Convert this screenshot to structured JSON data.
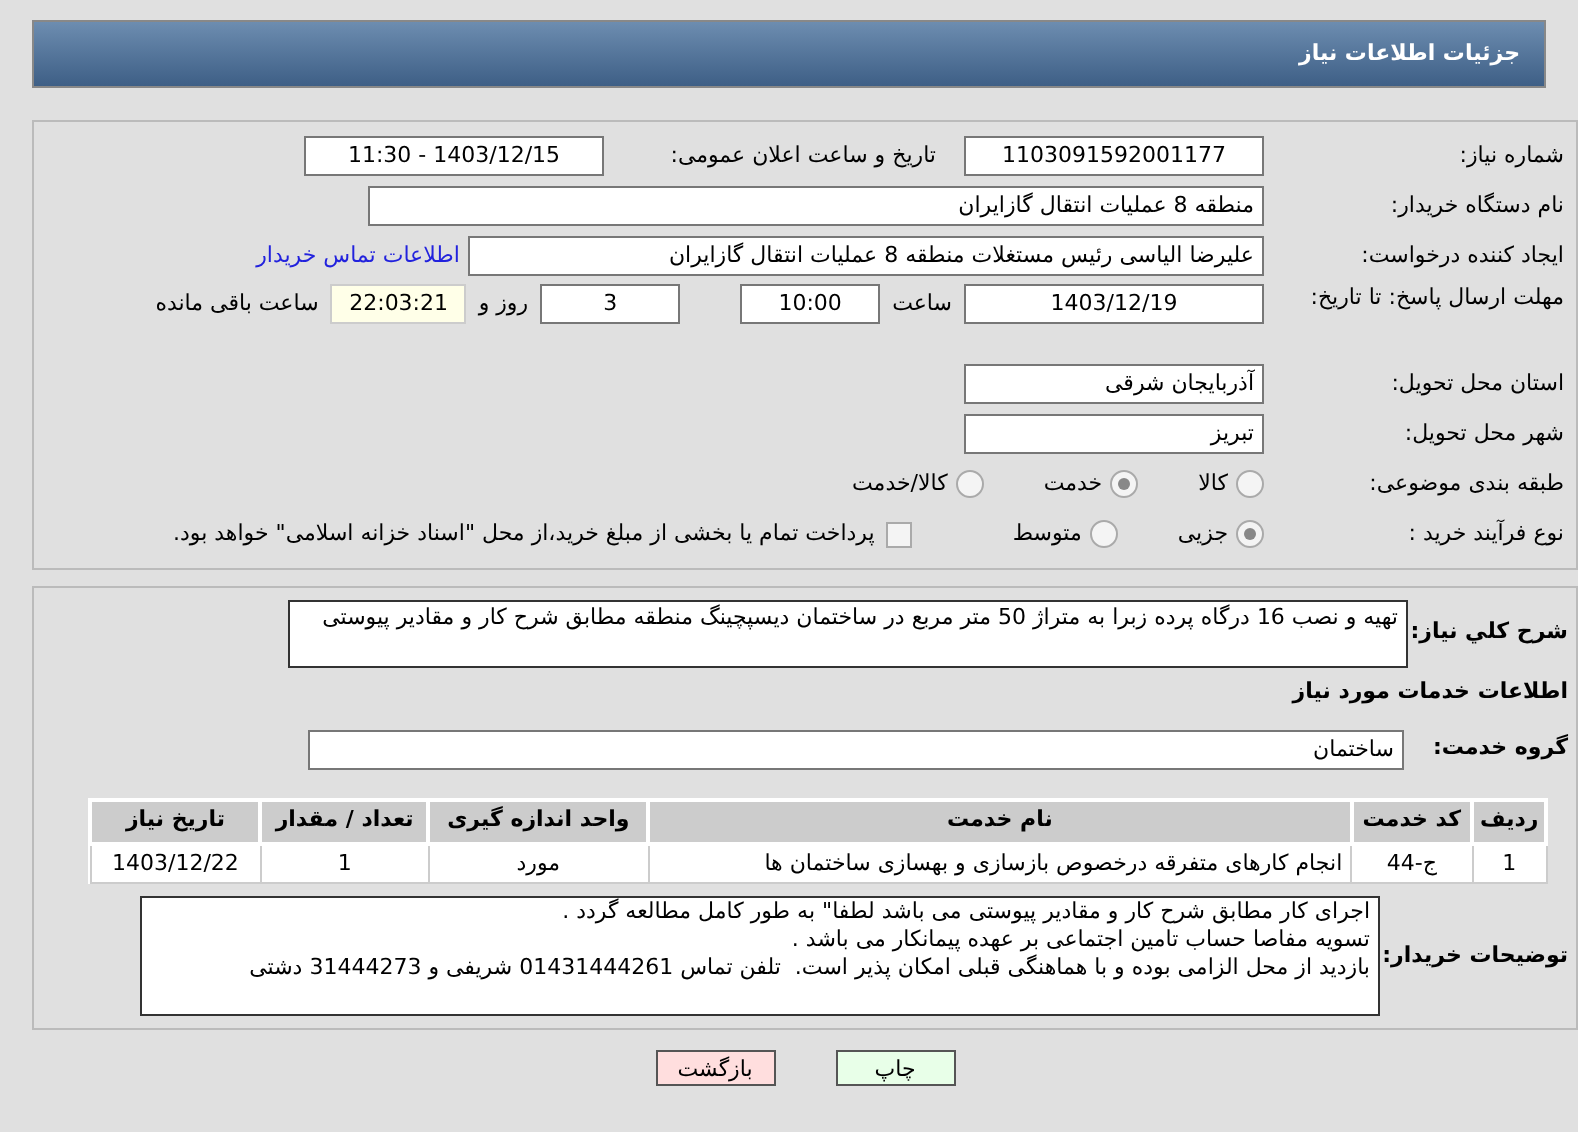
{
  "header": {
    "title": "جزئیات اطلاعات نیاز"
  },
  "details": {
    "need_number": {
      "label": "شماره نیاز:",
      "value": "1103091592001177"
    },
    "announce": {
      "label": "تاریخ و ساعت اعلان عمومی:",
      "value": "1403/12/15 - 11:30"
    },
    "buyer": {
      "label": "نام دستگاه خریدار:",
      "value": "منطقه 8 عملیات انتقال گازایران"
    },
    "creator": {
      "label": "ایجاد کننده درخواست:",
      "value": "علیرضا الیاسی رئیس مستغلات منطقه 8 عملیات انتقال گازایران",
      "link": "اطلاعات تماس خریدار"
    },
    "deadline": {
      "label": "مهلت ارسال پاسخ: تا تاریخ:",
      "date": "1403/12/19",
      "time_label": "ساعت",
      "time": "10:00",
      "days": "3",
      "days_label": "روز و",
      "remaining": "22:03:21",
      "remaining_label": "ساعت باقی مانده"
    },
    "province": {
      "label": "استان محل تحویل:",
      "value": "آذربایجان شرقی"
    },
    "city": {
      "label": "شهر محل تحویل:",
      "value": "تبریز"
    },
    "category": {
      "label": "طبقه بندی موضوعی:",
      "options": [
        {
          "label": "کالا",
          "selected": false
        },
        {
          "label": "خدمت",
          "selected": true
        },
        {
          "label": "کالا/خدمت",
          "selected": false
        }
      ]
    },
    "process": {
      "label": "نوع فرآیند خرید :",
      "options": [
        {
          "label": "جزیی",
          "selected": true
        },
        {
          "label": "متوسط",
          "selected": false
        }
      ],
      "payment": {
        "checked": false,
        "text": "پرداخت تمام یا بخشی از مبلغ خرید،از محل \"اسناد خزانه اسلامی\" خواهد بود."
      }
    }
  },
  "summary": {
    "label": "شرح کلي نیاز:",
    "value": "تهیه و نصب 16 درگاه پرده زبرا به متراژ 50 متر مربع در ساختمان دیسپچینگ منطقه مطابق شرح کار و مقادیر پیوستی"
  },
  "services_title": "اطلاعات خدمات مورد نیاز",
  "service_group": {
    "label": "گروه خدمت:",
    "value": "ساختمان"
  },
  "table": {
    "columns": [
      "ردیف",
      "کد خدمت",
      "نام خدمت",
      "واحد اندازه گیری",
      "تعداد / مقدار",
      "تاریخ نیاز"
    ],
    "rows": [
      [
        "1",
        "ج-44",
        "انجام کارهای متفرقه درخصوص بازسازی و بهسازی ساختمان ها",
        "مورد",
        "1",
        "1403/12/22"
      ]
    ]
  },
  "buyer_notes": {
    "label": "توضیحات خریدار:",
    "lines": [
      "اجرای کار مطابق شرح کار و مقادیر پیوستی می باشد لطفا\" به طور کامل مطالعه گردد .",
      "تسویه مفاصا حساب تامین اجتماعی بر عهده پیمانکار می باشد .",
      "بازدید از محل الزامی بوده و با هماهنگی قبلی امکان پذیر است.  تلفن تماس 01431444261 شریفی و 31444273 دشتی"
    ]
  },
  "buttons": [
    {
      "label": "چاپ",
      "kind": "print"
    },
    {
      "label": "بازگشت",
      "kind": "back"
    }
  ]
}
